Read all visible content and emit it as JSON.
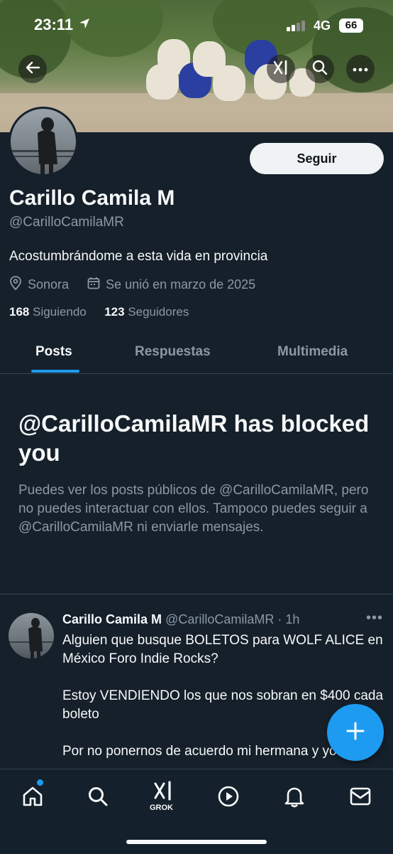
{
  "status": {
    "time": "23:11",
    "network": "4G",
    "battery": "66"
  },
  "profile": {
    "name": "Carillo Camila M",
    "handle": "@CarilloCamilaMR",
    "bio": "Acostumbrándome a esta vida en provincia",
    "location": "Sonora",
    "joined": "Se unió en marzo de 2025",
    "following_count": "168",
    "following_label": "Siguiendo",
    "followers_count": "123",
    "followers_label": "Seguidores",
    "follow_button": "Seguir"
  },
  "tabs": [
    {
      "label": "Posts",
      "active": true
    },
    {
      "label": "Respuestas",
      "active": false
    },
    {
      "label": "Multimedia",
      "active": false
    }
  ],
  "blocked": {
    "title": "@CarilloCamilaMR has blocked you",
    "message": "Puedes ver los posts públicos de @CarilloCamilaMR, pero no puedes interactuar con ellos. Tampoco puedes seguir a @CarilloCamilaMR ni enviarle mensajes."
  },
  "post": {
    "author": "Carillo Camila M",
    "handle": "@CarilloCamilaMR",
    "time": "· 1h",
    "more": "•••",
    "paragraphs": [
      "Alguien que busque BOLETOS para WOLF ALICE en México Foro Indie Rocks?",
      "Estoy VENDIENDO los que nos sobran en $400 cada boleto",
      "Por no ponernos de acuerdo mi hermana y yo"
    ]
  },
  "bottom_nav": {
    "grok_label": "GROK"
  },
  "icons": {
    "back": "arrow-left-icon",
    "grok_top": "grok-icon",
    "search": "search-icon",
    "more": "more-horizontal-icon",
    "location": "location-pin-icon",
    "calendar": "calendar-icon",
    "compose": "plus-icon",
    "home": "home-icon",
    "explore": "search-icon",
    "grok": "grok-icon",
    "video": "play-circle-icon",
    "notifications": "bell-icon",
    "messages": "envelope-icon"
  },
  "colors": {
    "accent": "#1d9bf0",
    "background": "#15202b",
    "muted": "#8b98a5"
  }
}
